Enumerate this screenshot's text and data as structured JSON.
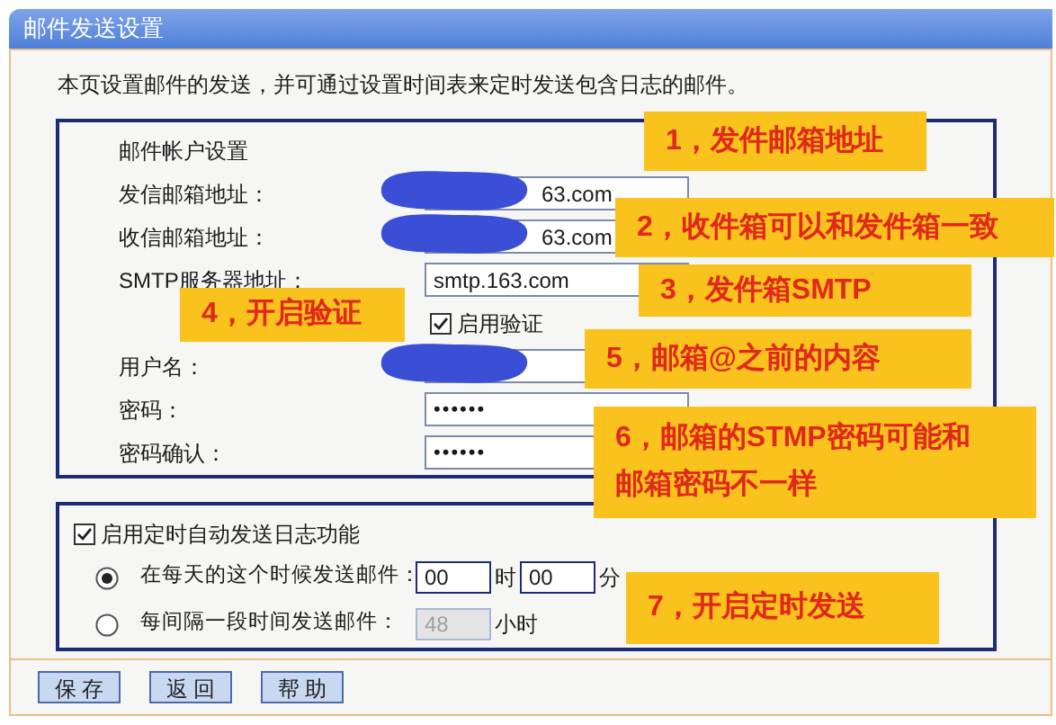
{
  "window": {
    "title": "邮件发送设置"
  },
  "description": "本页设置邮件的发送，并可通过设置时间表来定时发送包含日志的邮件。",
  "account": {
    "heading": "邮件帐户设置",
    "rows": [
      {
        "kind": "text",
        "label": "发信邮箱地址：",
        "value": "63.com",
        "redacted": true
      },
      {
        "kind": "text",
        "label": "收信邮箱地址：",
        "value": "63.com",
        "redacted": true
      },
      {
        "kind": "text",
        "label": "SMTP服务器地址：",
        "value": "smtp.163.com"
      },
      {
        "kind": "checkbox",
        "label": "启用验证",
        "checked": true
      },
      {
        "kind": "text",
        "label": "用户名：",
        "redacted": true
      },
      {
        "kind": "password",
        "label": "密码：",
        "value": "••••••"
      },
      {
        "kind": "password",
        "label": "密码确认：",
        "value": "••••••"
      }
    ]
  },
  "schedule": {
    "label": "启用定时自动发送日志功能",
    "checked": true,
    "options": [
      {
        "label": "在每天的这个时候发送邮件：",
        "selected": true,
        "disabled": false,
        "inputs": [
          {
            "value": "00",
            "unit": "时"
          },
          {
            "value": "00",
            "unit": "分"
          }
        ]
      },
      {
        "label": "每间隔一段时间发送邮件：",
        "selected": false,
        "disabled": true,
        "inputs": [
          {
            "value": "48",
            "unit": "小时"
          }
        ]
      }
    ]
  },
  "buttons": [
    "保 存",
    "返 回",
    "帮 助"
  ],
  "annotations": [
    {
      "lines": [
        "1，发件邮箱地址"
      ]
    },
    {
      "lines": [
        "2，收件箱可以和发件箱一致"
      ]
    },
    {
      "lines": [
        "3，发件箱SMTP"
      ]
    },
    {
      "lines": [
        "4，开启验证"
      ]
    },
    {
      "lines": [
        "5，邮箱@之前的内容"
      ]
    },
    {
      "lines": [
        "6，邮箱的STMP密码可能和",
        "邮箱密码不一样"
      ]
    },
    {
      "lines": [
        "7，开启定时发送"
      ]
    }
  ]
}
